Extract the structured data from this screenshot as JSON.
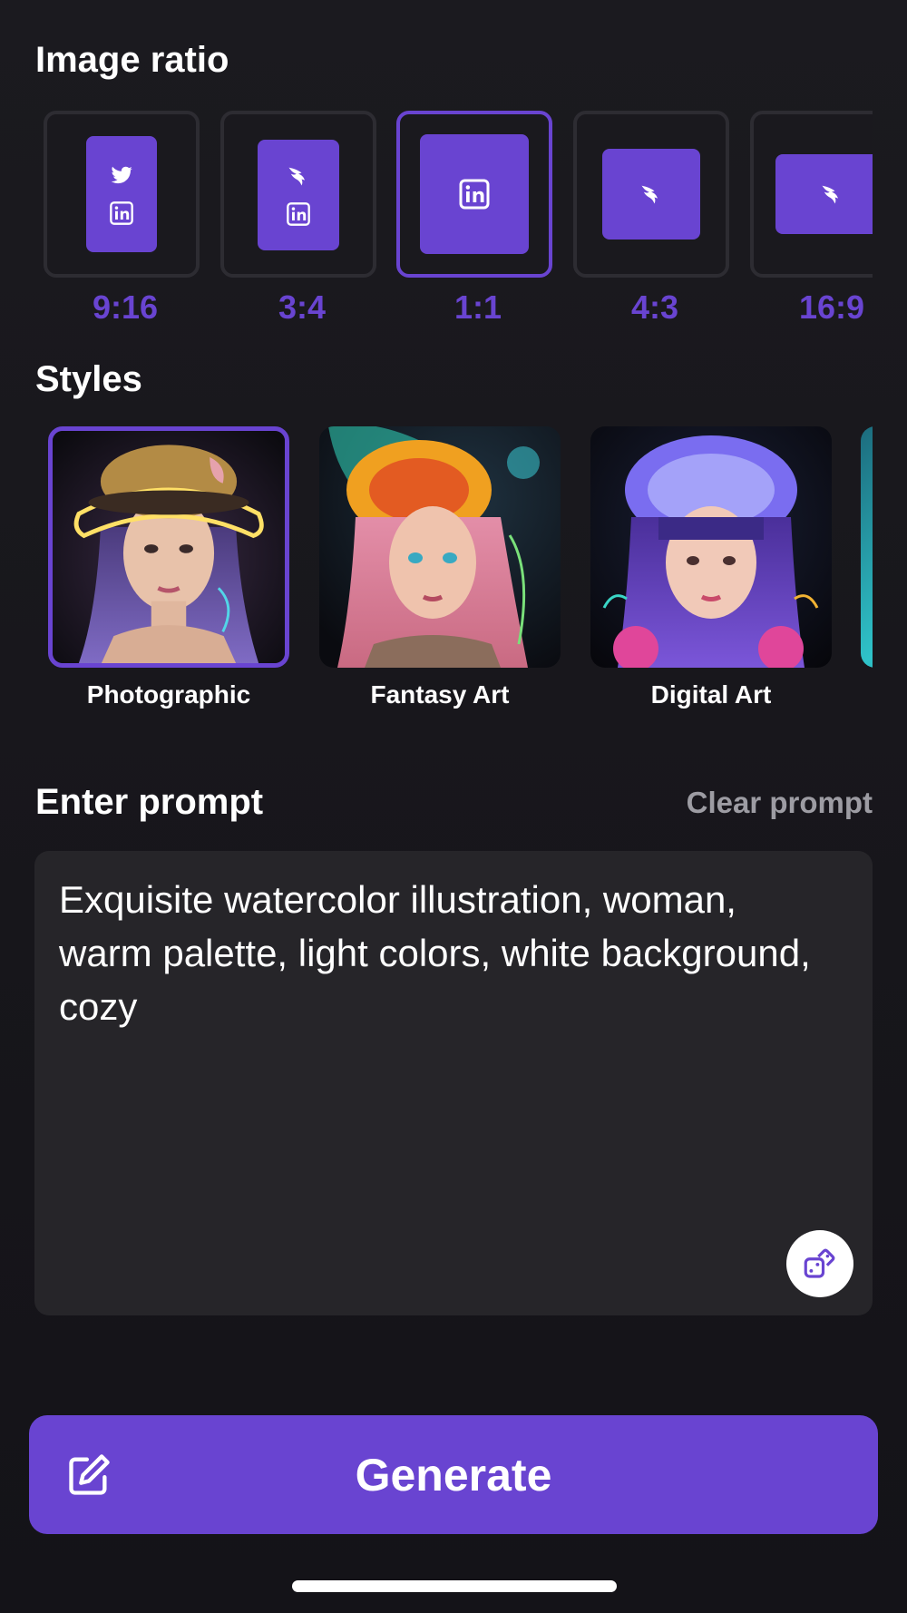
{
  "image_ratio": {
    "title": "Image ratio",
    "options": [
      {
        "label": "9:16",
        "icons": [
          "twitter-icon",
          "linkedin-icon"
        ],
        "selected": false
      },
      {
        "label": "3:4",
        "icons": [
          "bird-wing-icon",
          "linkedin-icon"
        ],
        "selected": false
      },
      {
        "label": "1:1",
        "icons": [
          "linkedin-icon"
        ],
        "selected": true
      },
      {
        "label": "4:3",
        "icons": [
          "bird-wing-icon"
        ],
        "selected": false
      },
      {
        "label": "16:9",
        "icons": [
          "bird-wing-icon"
        ],
        "selected": false
      }
    ]
  },
  "styles": {
    "title": "Styles",
    "items": [
      {
        "label": "Photographic",
        "selected": true
      },
      {
        "label": "Fantasy Art",
        "selected": false
      },
      {
        "label": "Digital Art",
        "selected": false
      }
    ]
  },
  "prompt": {
    "title": "Enter prompt",
    "clear_label": "Clear prompt",
    "value": "Exquisite watercolor illustration, woman, warm palette, light colors, white background, cozy",
    "randomize_icon": "dice-icon"
  },
  "generate": {
    "label": "Generate",
    "icon": "edit-icon"
  },
  "colors": {
    "accent": "#6944d1",
    "background": "#17161b",
    "input_background": "#262529",
    "muted_text": "#9d9ca3"
  }
}
